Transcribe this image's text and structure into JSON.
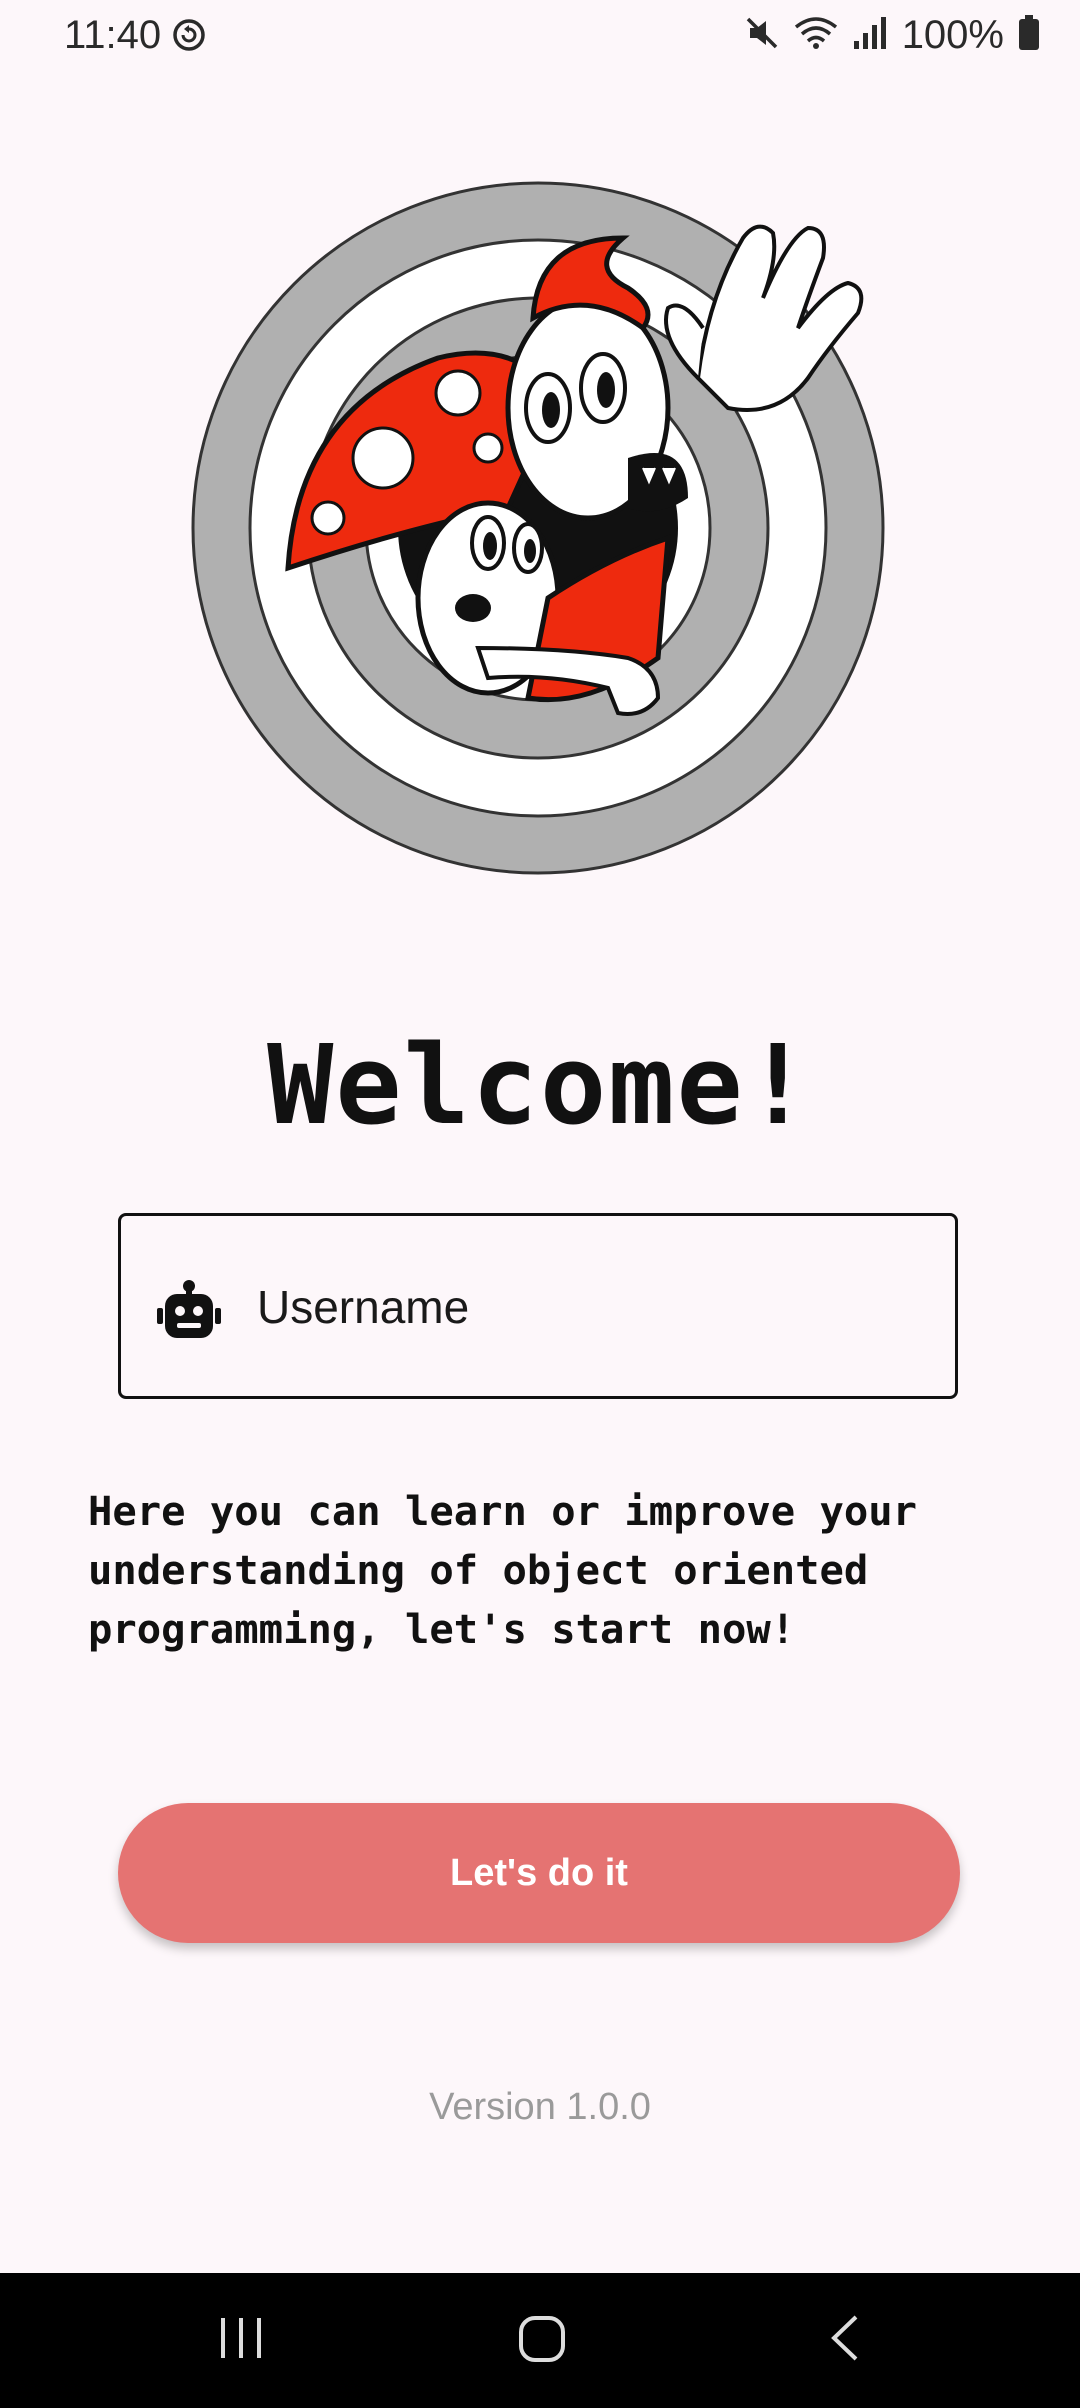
{
  "status_bar": {
    "time": "11:40",
    "battery": "100%",
    "icons": [
      "sync-icon",
      "mute-icon",
      "wifi-icon",
      "signal-icon",
      "battery-icon"
    ]
  },
  "logo": {
    "description_icon": "mushroom-mascot-logo"
  },
  "welcome": {
    "title": "Welcome!"
  },
  "username": {
    "placeholder": "Username",
    "value": "",
    "icon": "robot-icon"
  },
  "description": "Here you can learn or improve your understanding of object oriented programming, let's start now!",
  "cta": {
    "label": "Let's do it",
    "color": "#e57372"
  },
  "version": "Version 1.0.0",
  "nav_bar": {
    "buttons": [
      "recent-apps-icon",
      "home-icon",
      "back-icon"
    ]
  }
}
